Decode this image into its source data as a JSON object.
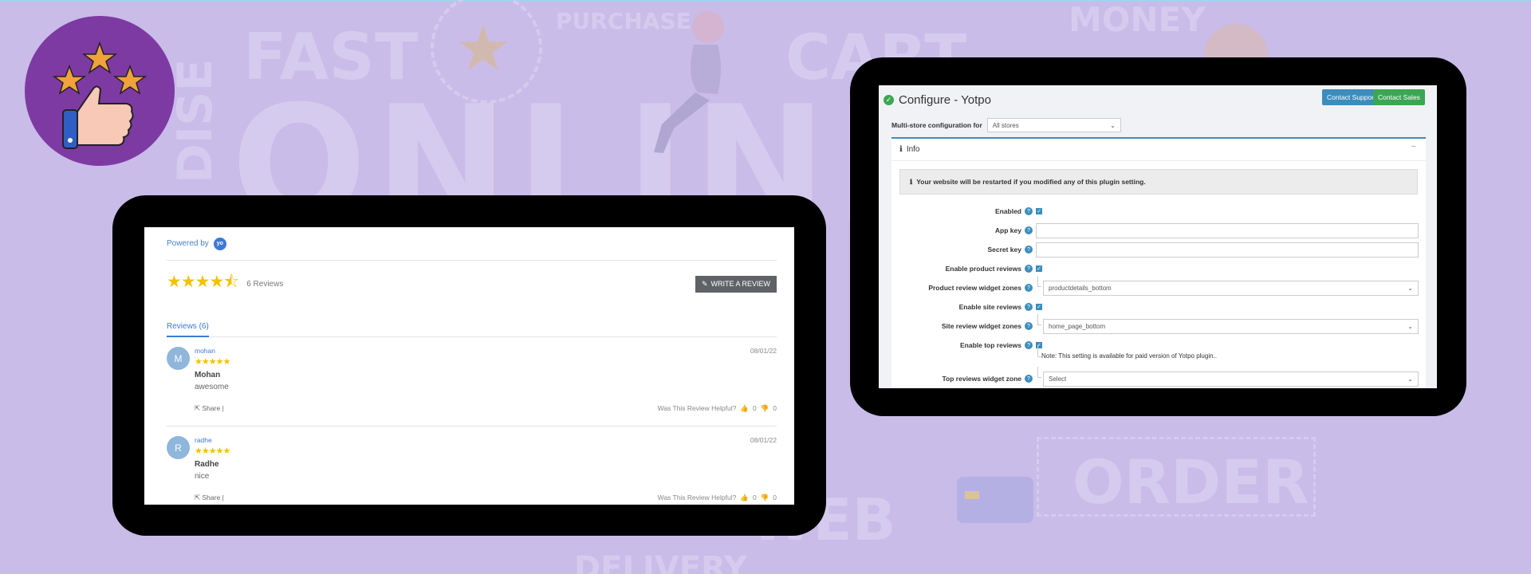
{
  "background": {
    "words": {
      "fast": "FAST",
      "purchase": "PURCHASE",
      "cart": "CART",
      "money": "MONEY",
      "online": "ONLINE",
      "dise": "DISE",
      "order": "ORDER",
      "web": "WEB",
      "delivery": "DELIVERY"
    },
    "colors": {
      "page": "#c9bce8",
      "badge": "#7e3aa3"
    }
  },
  "badge": {
    "icon": "thumbs-up-three-stars-icon"
  },
  "reviews_widget": {
    "powered_by": "Powered by",
    "logo_text": "yo",
    "stars": "★★★★⯪",
    "reviews_count": "6 Reviews",
    "write_review_label": "WRITE A REVIEW",
    "tab_label": "Reviews (6)",
    "star_color": "#f2c200",
    "items": [
      {
        "initial": "M",
        "name": "mohan",
        "date": "08/01/22",
        "stars": "★★★★★",
        "title": "Mohan",
        "body": "awesome",
        "share": "Share",
        "helpful": "Was This Review Helpful?",
        "up": "0",
        "down": "0"
      },
      {
        "initial": "R",
        "name": "radhe",
        "date": "08/01/22",
        "stars": "★★★★★",
        "title": "Radhe",
        "body": "nice",
        "share": "Share",
        "helpful": "Was This Review Helpful?",
        "up": "0",
        "down": "0"
      }
    ]
  },
  "admin": {
    "title": "Configure - Yotpo",
    "contact_support": "Contact Support",
    "contact_sales": "Contact Sales",
    "multi_store_label": "Multi-store configuration for",
    "multi_store_value": "All stores",
    "card_title": "Info",
    "collapse_symbol": "−",
    "callout": "Your website will be restarted if you modified any of this plugin setting.",
    "fields": {
      "enabled": "Enabled",
      "app_key": "App key",
      "secret_key": "Secret key",
      "enable_product_reviews": "Enable product reviews",
      "product_review_widget_zones": "Product review widget zones",
      "product_review_widget_zones_value": "productdetails_bottom",
      "enable_site_reviews": "Enable site reviews",
      "site_review_widget_zones": "Site review widget zones",
      "site_review_widget_zones_value": "home_page_bottom",
      "enable_top_reviews": "Enable top reviews",
      "top_reviews_note": "Note: This setting is available for paid version of Yotpo plugin..",
      "top_reviews_widget_zone": "Top reviews widget zone",
      "top_reviews_widget_zone_value": "Select"
    },
    "colors": {
      "primary": "#3c8dbc",
      "success": "#3ca654"
    }
  }
}
